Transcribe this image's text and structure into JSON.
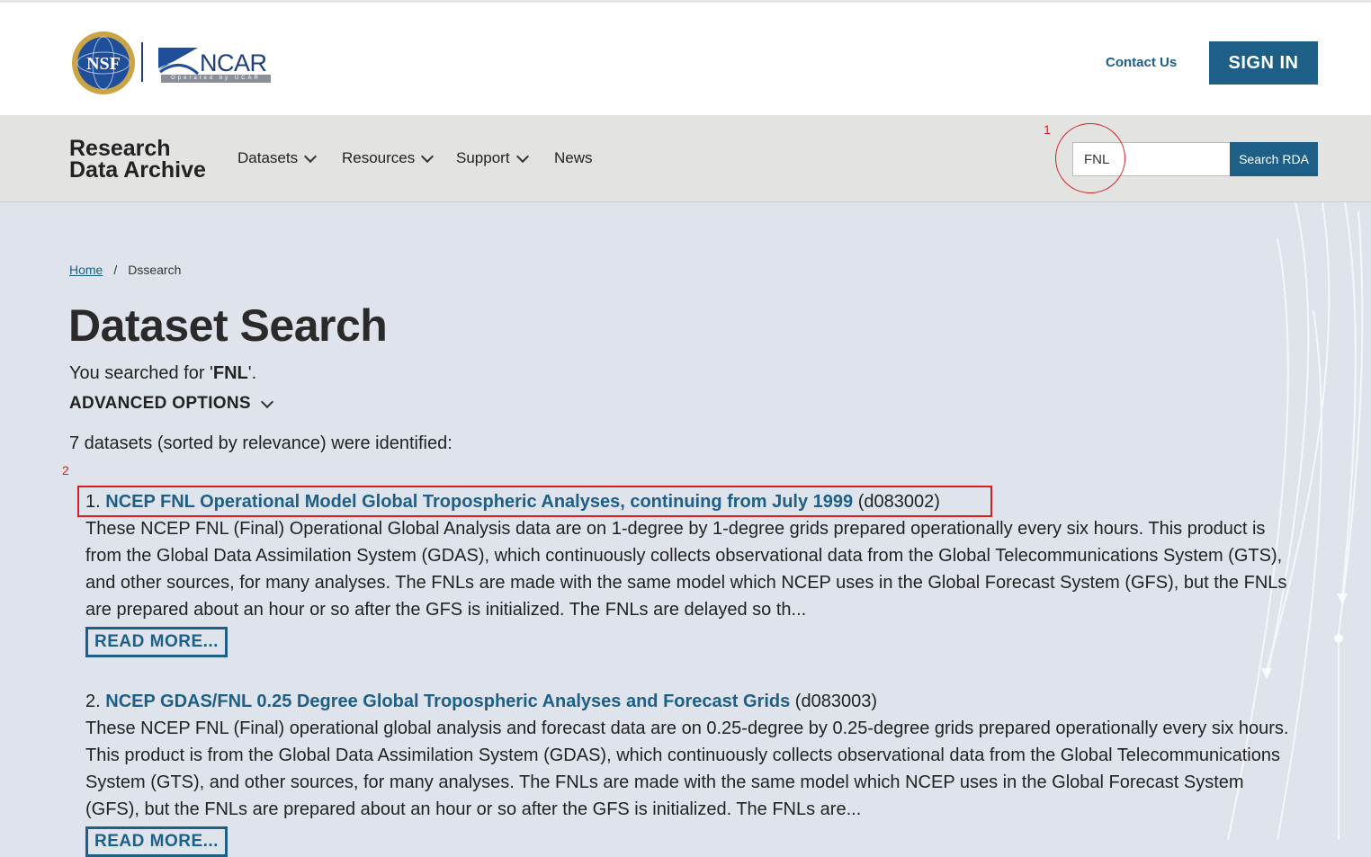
{
  "header": {
    "logo_nsf": "NSF",
    "logo_ncar": "NCAR",
    "logo_ncar_sub": "Operated by UCAR",
    "contact_label": "Contact Us",
    "signin_label": "SIGN IN"
  },
  "nav": {
    "title_line1": "Research",
    "title_line2": "Data Archive",
    "items": [
      {
        "label": "Datasets",
        "has_dropdown": true
      },
      {
        "label": "Resources",
        "has_dropdown": true
      },
      {
        "label": "Support",
        "has_dropdown": true
      },
      {
        "label": "News",
        "has_dropdown": false
      }
    ],
    "search_value": "FNL",
    "search_button": "Search RDA"
  },
  "annotations": {
    "marker1": "1",
    "marker2": "2"
  },
  "breadcrumb": {
    "home": "Home",
    "separator": "/",
    "current": "Dssearch"
  },
  "main": {
    "title": "Dataset Search",
    "searched_prefix": "You searched for '",
    "searched_term": "FNL",
    "searched_suffix": "'.",
    "advanced_label": "ADVANCED OPTIONS",
    "count_text": "7 datasets (sorted by relevance) were identified:",
    "read_more_label": "READ MORE..."
  },
  "results": [
    {
      "num": "1.",
      "title": "NCEP FNL Operational Model Global Tropospheric Analyses, continuing from July 1999",
      "id": "(d083002)",
      "desc": "These NCEP FNL (Final) Operational Global Analysis data are on 1-degree by 1-degree grids prepared operationally every six hours. This product is from the Global Data Assimilation System (GDAS), which continuously collects observational data from the Global Telecommunications System (GTS), and other sources, for many analyses. The FNLs are made with the same model which NCEP uses in the Global Forecast System (GFS), but the FNLs are prepared about an hour or so after the GFS is initialized. The FNLs are delayed so th..."
    },
    {
      "num": "2.",
      "title": "NCEP GDAS/FNL 0.25 Degree Global Tropospheric Analyses and Forecast Grids",
      "id": "(d083003)",
      "desc": "These NCEP FNL (Final) operational global analysis and forecast data are on 0.25-degree by 0.25-degree grids prepared operationally every six hours. This product is from the Global Data Assimilation System (GDAS), which continuously collects observational data from the Global Telecommunications System (GTS), and other sources, for many analyses. The FNLs are made with the same model which NCEP uses in the Global Forecast System (GFS), but the FNLs are prepared about an hour or so after the GFS is initialized. The FNLs are..."
    }
  ],
  "colors": {
    "brand_blue": "#1d5f86",
    "annotation_red": "#d81e1e",
    "page_bg": "#dfe4ec",
    "nav_bg": "#e3e3e1"
  }
}
